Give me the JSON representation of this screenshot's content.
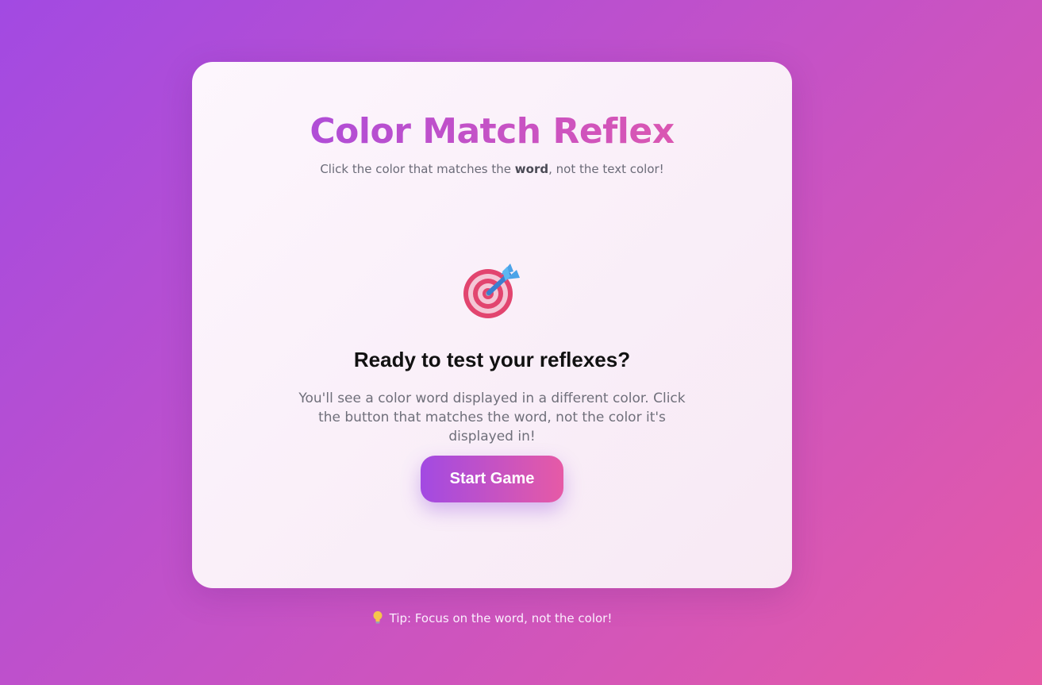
{
  "game": {
    "title": "Color Match Reflex",
    "subtitle_before": "Click the color that matches the ",
    "subtitle_bold": "word",
    "subtitle_after": ", not the text color!",
    "icon": "target-dart-icon",
    "heading": "Ready to test your reflexes?",
    "description": "You'll see a color word displayed in a different color. Click the button that matches the word, not the color it's displayed in!",
    "start_label": "Start Game"
  },
  "footer": {
    "tip_icon": "lightbulb-icon",
    "tip_text": "Tip: Focus on the word, not the color!"
  },
  "colors": {
    "gradient_start": "#a24ae2",
    "gradient_end": "#e65aa6",
    "card_background": "#fdf6fd",
    "heading_color": "#111111",
    "muted_text": "#6f6f7a"
  }
}
